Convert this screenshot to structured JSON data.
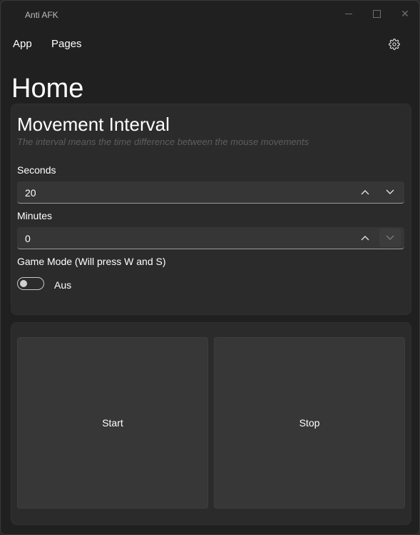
{
  "window": {
    "title": "Anti AFK",
    "minimize_icon": "minimize-icon",
    "maximize_icon": "maximize-icon",
    "close_icon": "close-icon",
    "close_glyph": "✕"
  },
  "menu": {
    "items": [
      {
        "label": "App"
      },
      {
        "label": "Pages"
      }
    ],
    "settings_icon": "gear-icon"
  },
  "page": {
    "title": "Home"
  },
  "settings": {
    "title": "Movement Interval",
    "description": "The interval means the time difference between the mouse movements",
    "seconds": {
      "label": "Seconds",
      "value": "20",
      "up_icon": "chevron-up-icon",
      "down_icon": "chevron-down-icon"
    },
    "minutes": {
      "label": "Minutes",
      "value": "0",
      "up_icon": "chevron-up-icon",
      "down_icon": "chevron-down-icon",
      "down_disabled": true
    },
    "game_mode": {
      "label": "Game Mode (Will press W and S)",
      "state_text": "Aus",
      "on": false
    }
  },
  "actions": {
    "start_label": "Start",
    "stop_label": "Stop"
  },
  "colors": {
    "window_bg": "#202020",
    "card_bg": "#2b2b2b",
    "input_bg": "#363636",
    "button_bg": "#373737",
    "muted_text": "#5e5e5e"
  }
}
